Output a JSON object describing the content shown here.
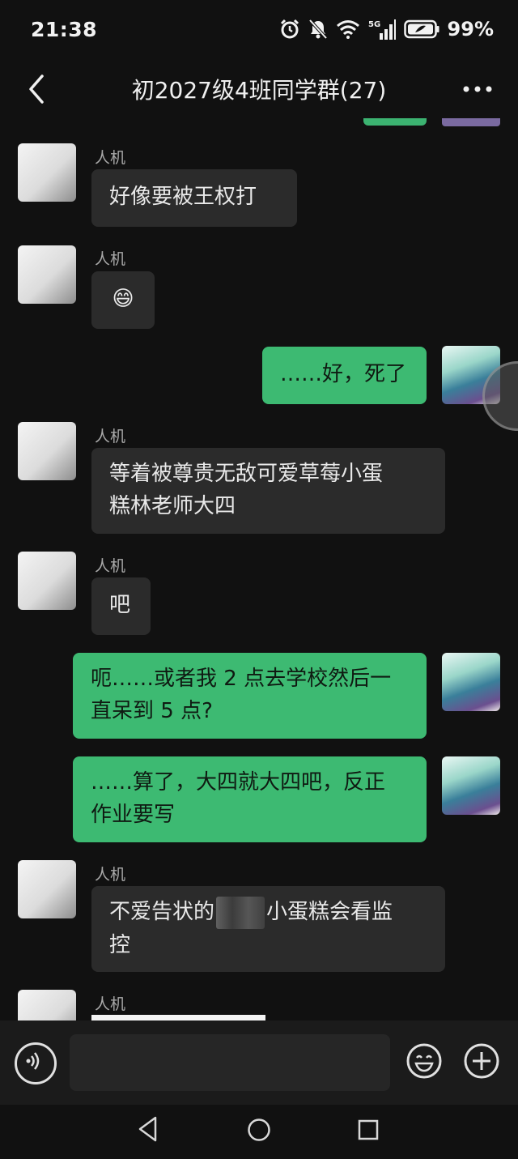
{
  "status_bar": {
    "time": "21:38",
    "battery": "99%",
    "network": "5G",
    "icons": [
      "alarm-icon",
      "mute-icon",
      "wifi-icon",
      "signal-icon",
      "battery-icon"
    ]
  },
  "header": {
    "title": "初2027级4班同学群(27)",
    "back_icon": "chevron-left-icon",
    "more_icon": "more-dots-icon"
  },
  "messages": [
    {
      "direction": "in",
      "sender": "人机",
      "text": "好像要被王权打"
    },
    {
      "direction": "in",
      "sender": "人机",
      "text": "😄"
    },
    {
      "direction": "out",
      "text": "……好，死了"
    },
    {
      "direction": "in",
      "sender": "人机",
      "text_lines": [
        "等着被尊贵无敌可爱草莓小蛋",
        "糕林老师大四"
      ]
    },
    {
      "direction": "in",
      "sender": "人机",
      "text": "吧"
    },
    {
      "direction": "out",
      "text_lines": [
        "呃……或者我 2 点去学校然后一",
        "直呆到 5 点?"
      ]
    },
    {
      "direction": "out",
      "text_lines": [
        "……算了，大四就大四吧，反正",
        "作业要写"
      ]
    },
    {
      "direction": "in",
      "sender": "人机",
      "text_parts": [
        "不爱告状的",
        "小蛋糕会看监"
      ],
      "text_line2": "控"
    },
    {
      "direction": "in",
      "sender": "人机"
    }
  ],
  "input_bar": {
    "placeholder": "",
    "voice_icon": "voice-icon",
    "emoji_icon": "emoji-icon",
    "plus_icon": "plus-icon"
  },
  "nav_bar": {
    "icons": [
      "nav-back-icon",
      "nav-home-icon",
      "nav-recents-icon"
    ]
  },
  "colors": {
    "background": "#111111",
    "incoming_bubble": "#2b2b2b",
    "outgoing_bubble": "#3dba72",
    "sender_text": "#a9a9a9"
  }
}
